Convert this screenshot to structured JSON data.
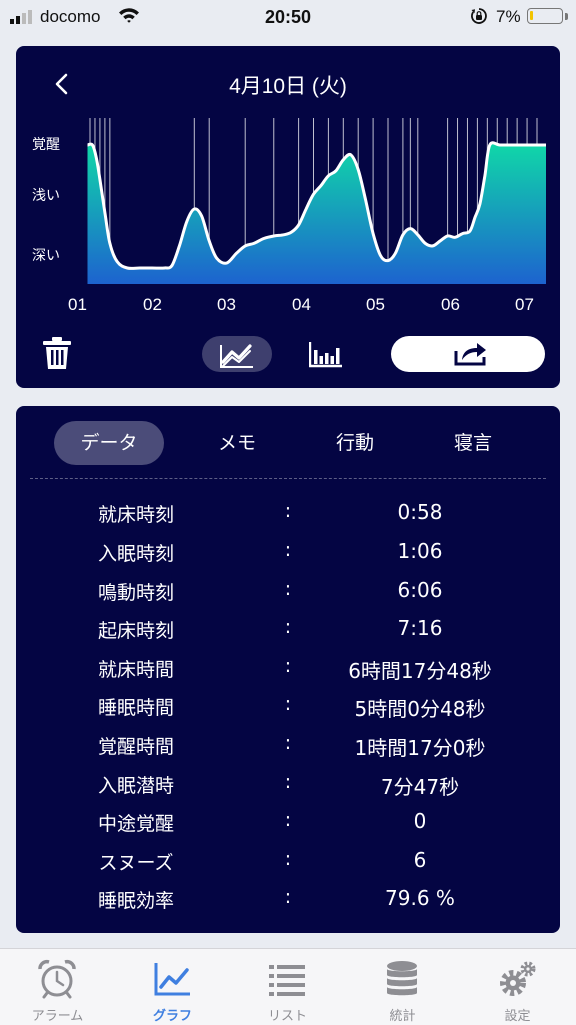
{
  "status_bar": {
    "carrier": "docomo",
    "time": "20:50",
    "battery": "7%"
  },
  "header": {
    "date_title": "4月10日 (火)"
  },
  "chart_data": {
    "type": "area",
    "y_levels": [
      "覚醒",
      "浅い",
      "深い"
    ],
    "x_ticks": [
      "01",
      "02",
      "03",
      "04",
      "05",
      "06",
      "07"
    ],
    "x": [
      "00:58",
      "01:02",
      "01:05",
      "01:08",
      "01:12",
      "01:16",
      "01:22",
      "01:30",
      "01:40",
      "01:50",
      "02:00",
      "02:06",
      "02:12",
      "02:18",
      "02:24",
      "02:30",
      "02:36",
      "02:42",
      "02:50",
      "02:58",
      "03:05",
      "03:12",
      "03:20",
      "03:28",
      "03:36",
      "03:42",
      "03:48",
      "03:54",
      "04:00",
      "04:06",
      "04:12",
      "04:18",
      "04:24",
      "04:30",
      "04:36",
      "04:42",
      "04:48",
      "04:54",
      "05:00",
      "05:06",
      "05:12",
      "05:18",
      "05:24",
      "05:30",
      "05:36",
      "05:42",
      "05:48",
      "05:54",
      "06:00",
      "06:06",
      "06:10",
      "06:14",
      "06:18",
      "06:22",
      "06:30",
      "06:40",
      "06:50",
      "07:00",
      "07:10",
      "07:16"
    ],
    "y": [
      1.0,
      1.0,
      0.9,
      0.72,
      0.45,
      0.2,
      0.05,
      0.0,
      0.0,
      0.0,
      0.0,
      0.02,
      0.18,
      0.38,
      0.48,
      0.42,
      0.22,
      0.08,
      0.04,
      0.12,
      0.18,
      0.2,
      0.24,
      0.26,
      0.27,
      0.29,
      0.35,
      0.48,
      0.6,
      0.67,
      0.75,
      0.79,
      0.88,
      0.92,
      0.8,
      0.55,
      0.28,
      0.1,
      0.06,
      0.12,
      0.27,
      0.32,
      0.27,
      0.2,
      0.18,
      0.22,
      0.26,
      0.25,
      0.28,
      0.3,
      0.41,
      0.52,
      0.75,
      1.0,
      1.0,
      1.0,
      1.0,
      1.0,
      1.0,
      1.0
    ],
    "wake_markers": [
      "01:00",
      "01:04",
      "01:08",
      "01:12",
      "01:16",
      "02:24",
      "02:36",
      "03:05",
      "03:28",
      "03:48",
      "04:00",
      "04:12",
      "04:24",
      "04:36",
      "04:48",
      "05:00",
      "05:12",
      "05:18",
      "05:24",
      "05:48",
      "05:56",
      "06:04",
      "06:12",
      "06:20",
      "06:28",
      "06:36",
      "06:44",
      "06:52",
      "07:00",
      "07:08",
      "07:16"
    ],
    "colors": {
      "fill_top": "#10d8a8",
      "fill_bottom": "#1d63cf",
      "line": "#ffffff"
    }
  },
  "toolbar": {
    "trash_icon": "trash-icon",
    "line_chart_icon": "line-chart-icon",
    "bar_chart_icon": "bar-chart-icon",
    "share_icon": "share-icon"
  },
  "tabs": [
    "データ",
    "メモ",
    "行動",
    "寝言"
  ],
  "stats": [
    {
      "label": "就床時刻",
      "value": "0:58"
    },
    {
      "label": "入眠時刻",
      "value": "1:06"
    },
    {
      "label": "鳴動時刻",
      "value": "6:06"
    },
    {
      "label": "起床時刻",
      "value": "7:16"
    },
    {
      "label": "就床時間",
      "value": "6時間17分48秒"
    },
    {
      "label": "睡眠時間",
      "value": "5時間0分48秒"
    },
    {
      "label": "覚醒時間",
      "value": "1時間17分0秒"
    },
    {
      "label": "入眠潜時",
      "value": "7分47秒"
    },
    {
      "label": "中途覚醒",
      "value": "0"
    },
    {
      "label": "スヌーズ",
      "value": "6"
    },
    {
      "label": "睡眠効率",
      "value": "79.6 %"
    }
  ],
  "colon": ":",
  "tab_bar": {
    "items": [
      {
        "label": "アラーム",
        "icon": "alarm-clock-icon"
      },
      {
        "label": "グラフ",
        "icon": "graph-icon"
      },
      {
        "label": "リスト",
        "icon": "list-icon"
      },
      {
        "label": "統計",
        "icon": "database-icon"
      },
      {
        "label": "設定",
        "icon": "gear-icon"
      }
    ],
    "active_color": "#3f7fe0",
    "inactive_color": "#8e8e93"
  }
}
